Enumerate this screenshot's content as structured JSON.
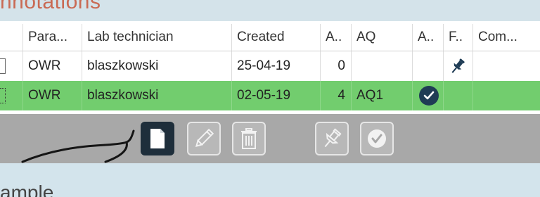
{
  "section_header": "nnotations",
  "grid": {
    "columns": [
      "Para...",
      "Lab technician",
      "Created",
      "A..",
      "AQ",
      "A..",
      "F..",
      "Com..."
    ],
    "rows": [
      {
        "param": "OWR",
        "technician": "blaszkowski",
        "created": "25-04-19",
        "count": "0",
        "aq": "",
        "accepted_icon": "",
        "flag_icon": "pin-icon",
        "comment": ""
      },
      {
        "param": "OWR",
        "technician": "blaszkowski",
        "created": "02-05-19",
        "count": "4",
        "aq": "AQ1",
        "accepted_icon": "check-circle-icon",
        "flag_icon": "",
        "comment": "",
        "selected": true
      }
    ],
    "selected_row_color": "#72cd6e"
  },
  "toolbar": {
    "buttons": [
      {
        "name": "new-document-button",
        "icon": "document-icon",
        "enabled": true
      },
      {
        "name": "edit-button",
        "icon": "pencil-icon",
        "enabled": false
      },
      {
        "name": "delete-button",
        "icon": "trash-icon",
        "enabled": false
      },
      {
        "name": "pin-button",
        "icon": "pin-icon",
        "enabled": false
      },
      {
        "name": "approve-button",
        "icon": "check-icon",
        "enabled": false
      }
    ]
  },
  "bottom_section_header": "ample",
  "colors": {
    "header_text": "#c96a54",
    "toolbar_bg": "#a8a8a8",
    "active_button": "#1e2e3b",
    "accent_check": "#1f3c55"
  }
}
